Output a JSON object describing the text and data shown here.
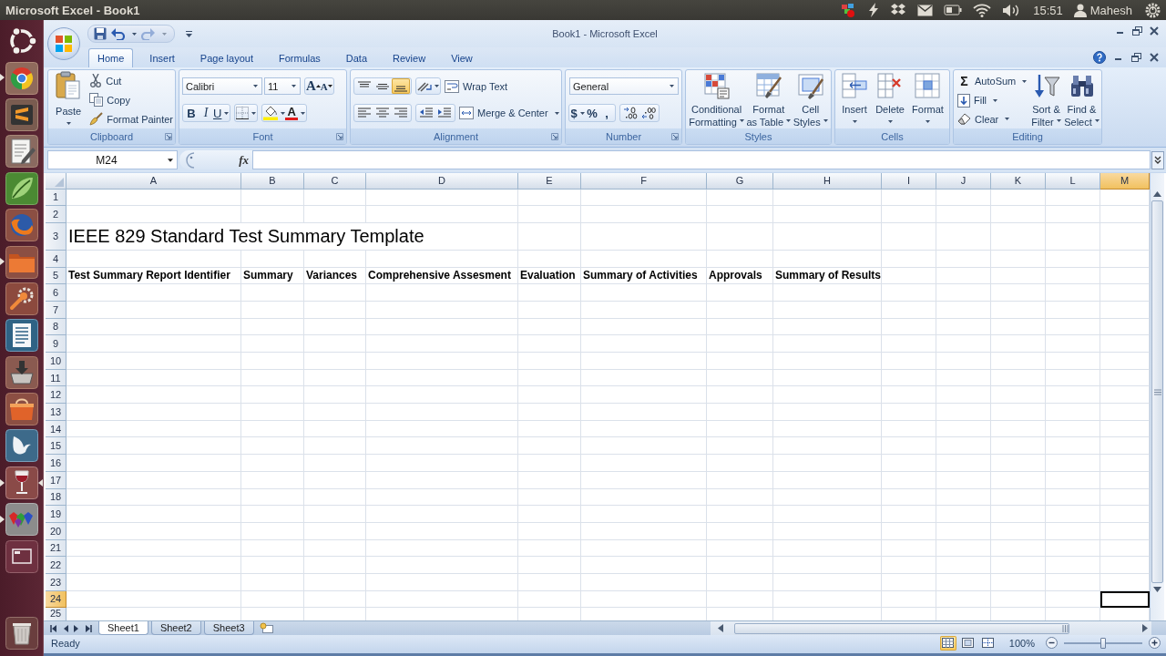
{
  "top_panel": {
    "title": "Microsoft Excel - Book1",
    "clock": "15:51",
    "user": "Mahesh"
  },
  "launcher": [
    {
      "running": false,
      "focused": false
    },
    {
      "running": true,
      "focused": false
    },
    {
      "running": false,
      "focused": false
    },
    {
      "running": false,
      "focused": false
    },
    {
      "running": false,
      "focused": false
    },
    {
      "running": false,
      "focused": false
    },
    {
      "running": true,
      "focused": false
    },
    {
      "running": false,
      "focused": false
    },
    {
      "running": false,
      "focused": false
    },
    {
      "running": false,
      "focused": false
    },
    {
      "running": false,
      "focused": false
    },
    {
      "running": false,
      "focused": false
    },
    {
      "running": true,
      "focused": true
    },
    {
      "running": true,
      "focused": false
    },
    {
      "running": false,
      "focused": false
    },
    {
      "running": false,
      "focused": false
    }
  ],
  "window": {
    "title": "Book1 - Microsoft Excel",
    "quick_access": {
      "undo": {
        "disabled": false
      },
      "redo": {
        "disabled": true
      }
    }
  },
  "ribbon": {
    "tabs": [
      {
        "label": "Home",
        "selected": true
      },
      {
        "label": "Insert",
        "selected": false
      },
      {
        "label": "Page layout",
        "selected": false
      },
      {
        "label": "Formulas",
        "selected": false
      },
      {
        "label": "Data",
        "selected": false
      },
      {
        "label": "Review",
        "selected": false
      },
      {
        "label": "View",
        "selected": false
      }
    ],
    "clipboard": {
      "label": "Clipboard",
      "paste": "Paste",
      "cut": "Cut",
      "copy": "Copy",
      "format_painter": "Format Painter"
    },
    "font": {
      "label": "Font",
      "name": "Calibri",
      "size": "11",
      "grow": "A",
      "shrink": "A",
      "bold": "B",
      "italic": "I",
      "underline": "U",
      "ink": "A"
    },
    "alignment": {
      "label": "Alignment",
      "vertical": [
        {
          "selected": false
        },
        {
          "selected": false
        },
        {
          "selected": true
        }
      ],
      "horizontal": [
        {
          "selected": false
        },
        {
          "selected": false
        },
        {
          "selected": false
        }
      ],
      "wrap_text": "Wrap Text",
      "merge": "Merge & Center"
    },
    "number": {
      "label": "Number",
      "format": "General",
      "currency": "$",
      "percent": "%",
      "comma": ","
    },
    "styles": {
      "label": "Styles",
      "buttons": [
        {
          "lines": [
            "Conditional",
            "Formatting"
          ]
        },
        {
          "lines": [
            "Format",
            "as Table"
          ]
        },
        {
          "lines": [
            "Cell",
            "Styles"
          ]
        }
      ]
    },
    "cells": {
      "label": "Cells",
      "buttons": [
        "Insert",
        "Delete",
        "Format"
      ]
    },
    "editing": {
      "label": "Editing",
      "autosum": {
        "symbol": "Σ",
        "label": "AutoSum"
      },
      "fill": "Fill",
      "clear": "Clear",
      "sort": [
        "Sort &",
        "Filter"
      ],
      "find": [
        "Find &",
        "Select"
      ]
    }
  },
  "formula_bar": {
    "name_box": "M24",
    "function": "fx"
  },
  "sheet": {
    "columns": [
      {
        "label": "A",
        "selected": false
      },
      {
        "label": "B",
        "selected": false
      },
      {
        "label": "C",
        "selected": false
      },
      {
        "label": "D",
        "selected": false
      },
      {
        "label": "E",
        "selected": false
      },
      {
        "label": "F",
        "selected": false
      },
      {
        "label": "G",
        "selected": false
      },
      {
        "label": "H",
        "selected": false
      },
      {
        "label": "I",
        "selected": false
      },
      {
        "label": "J",
        "selected": false
      },
      {
        "label": "K",
        "selected": false
      },
      {
        "label": "L",
        "selected": false
      },
      {
        "label": "M",
        "selected": true
      }
    ],
    "rows": [
      {
        "label": "1",
        "selected": false
      },
      {
        "label": "2",
        "selected": false
      },
      {
        "label": "3",
        "selected": false,
        "cells": [
          {
            "text": "IEEE 829 Standard Test Summary Template",
            "kind": "title"
          }
        ]
      },
      {
        "label": "4",
        "selected": false
      },
      {
        "label": "5",
        "selected": false,
        "cells": [
          {
            "text": "Test Summary Report Identifier",
            "kind": "heading"
          },
          {
            "text": "Summary",
            "kind": "heading"
          },
          {
            "text": "Variances",
            "kind": "heading"
          },
          {
            "text": "Comprehensive Assesment",
            "kind": "heading"
          },
          {
            "text": "Evaluation",
            "kind": "heading"
          },
          {
            "text": "Summary of Activities",
            "kind": "heading"
          },
          {
            "text": "Approvals",
            "kind": "heading"
          },
          {
            "text": "Summary of Results",
            "kind": "heading"
          }
        ]
      },
      {
        "label": "6",
        "selected": false
      },
      {
        "label": "7",
        "selected": false
      },
      {
        "label": "8",
        "selected": false
      },
      {
        "label": "9",
        "selected": false
      },
      {
        "label": "10",
        "selected": false
      },
      {
        "label": "11",
        "selected": false
      },
      {
        "label": "12",
        "selected": false
      },
      {
        "label": "13",
        "selected": false
      },
      {
        "label": "14",
        "selected": false
      },
      {
        "label": "15",
        "selected": false
      },
      {
        "label": "16",
        "selected": false
      },
      {
        "label": "17",
        "selected": false
      },
      {
        "label": "18",
        "selected": false
      },
      {
        "label": "19",
        "selected": false
      },
      {
        "label": "20",
        "selected": false
      },
      {
        "label": "21",
        "selected": false
      },
      {
        "label": "22",
        "selected": false
      },
      {
        "label": "23",
        "selected": false
      },
      {
        "label": "24",
        "selected": true
      },
      {
        "label": "25",
        "selected": false
      }
    ]
  },
  "sheet_tabs": [
    {
      "label": "Sheet1",
      "selected": true
    },
    {
      "label": "Sheet2",
      "selected": false
    },
    {
      "label": "Sheet3",
      "selected": false
    }
  ],
  "status_bar": {
    "text": "Ready",
    "views": [
      {
        "selected": true
      },
      {
        "selected": false
      },
      {
        "selected": false
      }
    ],
    "zoom": "100%",
    "zoom_slider": {
      "level": 0.5
    }
  }
}
